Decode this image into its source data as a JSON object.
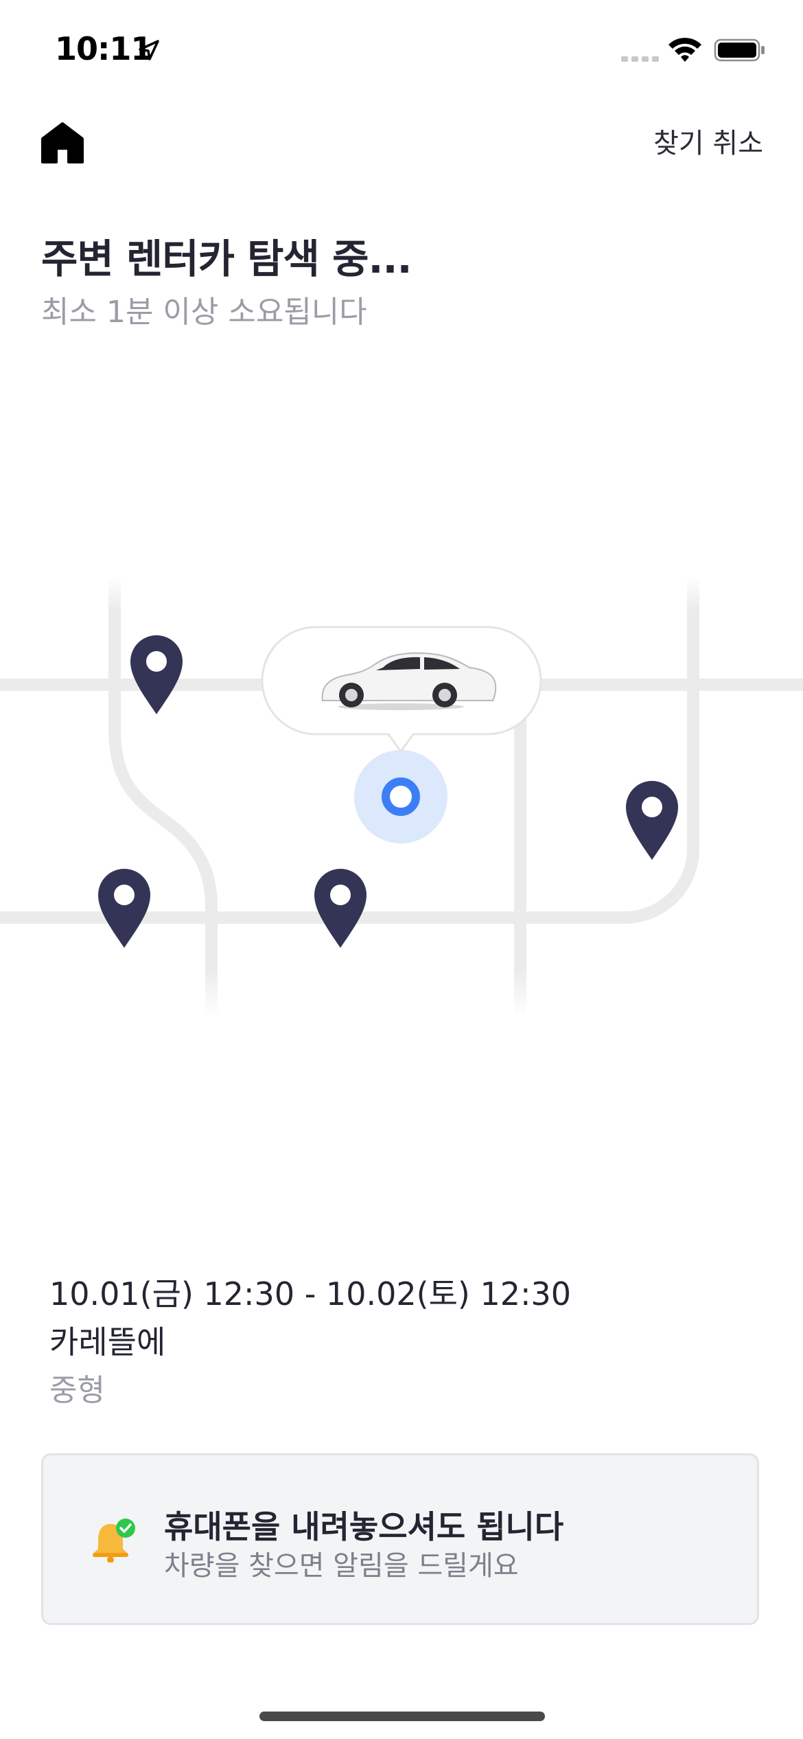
{
  "status_bar": {
    "time": "10:11"
  },
  "header": {
    "cancel_label": "찾기 취소"
  },
  "search": {
    "title": "주변 렌터카 탐색 중...",
    "subtitle": "최소 1분 이상 소요됩니다"
  },
  "booking": {
    "period": "10.01(금) 12:30 - 10.02(토) 12:30",
    "car_name": "카레뜰에",
    "car_class": "중형"
  },
  "notice": {
    "title": "휴대폰을 내려놓으셔도 됩니다",
    "description": "차량을 찾으면 알림을 드릴게요"
  },
  "colors": {
    "pin": "#343457",
    "user_location": "#3d7ef7",
    "user_halo": "#dce8fb",
    "road": "#ebebeb",
    "bell": "#f6b93b",
    "check": "#2ec84b"
  },
  "icons": [
    "home-icon",
    "location-arrow-icon",
    "signal-icon",
    "wifi-icon",
    "battery-icon",
    "map-pin-icon",
    "car-icon",
    "bell-icon",
    "check-icon"
  ]
}
